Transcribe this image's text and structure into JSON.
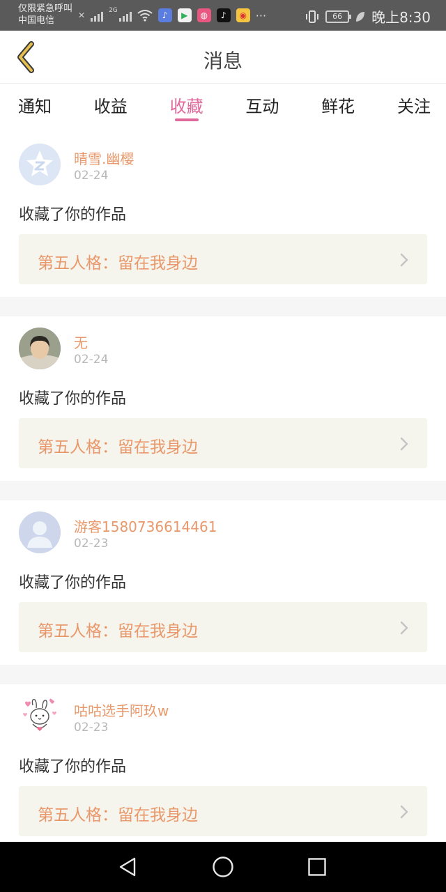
{
  "status_bar": {
    "carrier_line1": "仅限紧急呼叫",
    "carrier_line2": "中国电信",
    "network": "2G",
    "battery": "66",
    "time": "晚上8:30",
    "more": "···"
  },
  "header": {
    "title": "消息"
  },
  "tabs": [
    {
      "label": "通知",
      "active": false
    },
    {
      "label": "收益",
      "active": false
    },
    {
      "label": "收藏",
      "active": true
    },
    {
      "label": "互动",
      "active": false
    },
    {
      "label": "鲜花",
      "active": false
    },
    {
      "label": "关注",
      "active": false
    }
  ],
  "messages": [
    {
      "user": "晴雪.幽樱",
      "date": "02-24",
      "action": "收藏了你的作品",
      "work_title": "第五人格：留在我身边",
      "avatar_icon": "qzone-star-avatar"
    },
    {
      "user": "无",
      "date": "02-24",
      "action": "收藏了你的作品",
      "work_title": "第五人格：留在我身边",
      "avatar_icon": "photo-avatar"
    },
    {
      "user": "游客1580736614461",
      "date": "02-23",
      "action": "收藏了你的作品",
      "work_title": "第五人格：留在我身边",
      "avatar_icon": "default-person-avatar"
    },
    {
      "user": "咕咕选手阿玖w",
      "date": "02-23",
      "action": "收藏了你的作品",
      "work_title": "第五人格：留在我身边",
      "avatar_icon": "rabbit-hearts-avatar"
    }
  ],
  "colors": {
    "accent": "#e0689b",
    "username": "#e8986a",
    "work_bg": "#f5f4ed",
    "back_icon": "#e0b84a"
  }
}
